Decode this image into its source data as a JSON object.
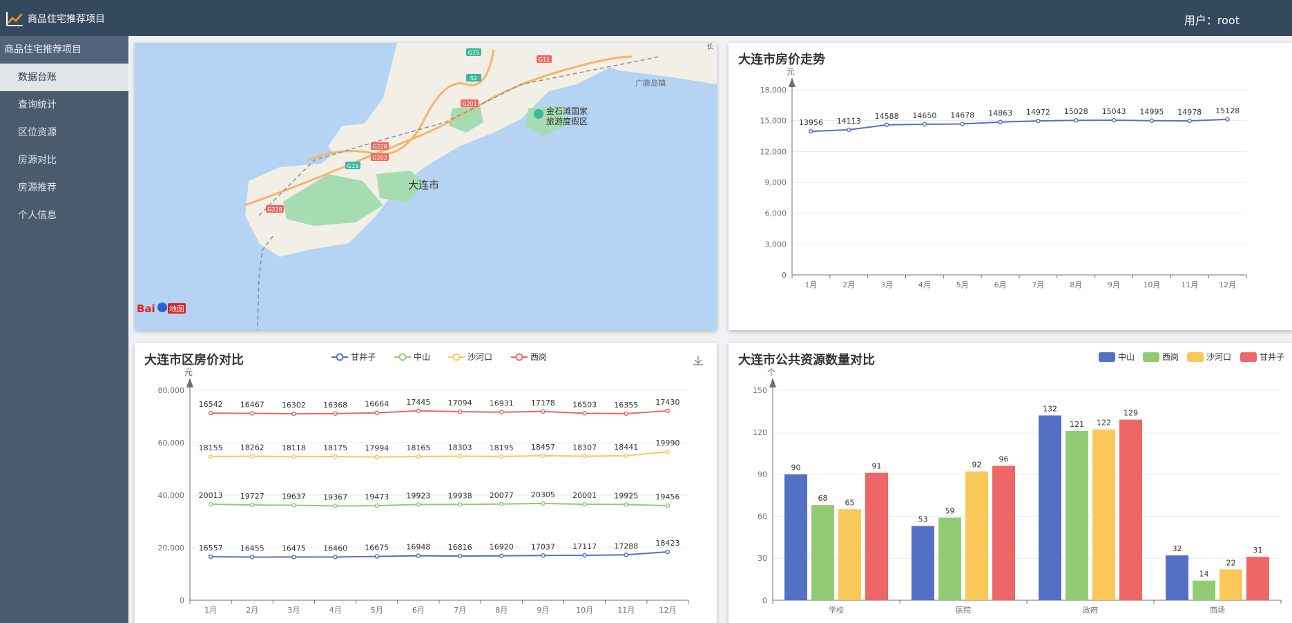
{
  "app": {
    "title": "商品住宅推荐项目",
    "user_label": "用户：root"
  },
  "sidebar": {
    "group_label": "商品住宅推荐项目",
    "items": [
      {
        "label": "数据台账",
        "active": true
      },
      {
        "label": "查询统计",
        "active": false
      },
      {
        "label": "区位资源",
        "active": false
      },
      {
        "label": "房源对比",
        "active": false
      },
      {
        "label": "房源推荐",
        "active": false
      },
      {
        "label": "个人信息",
        "active": false
      }
    ]
  },
  "map": {
    "city_label": "大连市",
    "poi_label_1": "金石滩国家",
    "poi_label_2": "旅游度假区",
    "place_label": "广鹿岛镇",
    "edge_label": "长",
    "road_labels": [
      "G15",
      "G11",
      "S2",
      "G201",
      "G228",
      "G202",
      "G15",
      "G228"
    ],
    "logo_text_1": "Bai",
    "logo_text_2": "地图"
  },
  "trend_chart": {
    "title": "大连市房价走势",
    "unit": "元"
  },
  "district_chart": {
    "title": "大连市区房价对比",
    "unit": "元"
  },
  "resource_chart": {
    "title": "大连市公共资源数量对比",
    "unit": "个"
  },
  "colors": {
    "blue": "#5470c6",
    "green": "#91cc75",
    "yellow": "#fac858",
    "red": "#ee6666"
  },
  "chart_data": [
    {
      "type": "line",
      "title": "大连市房价走势",
      "ylabel": "元",
      "categories": [
        "1月",
        "2月",
        "3月",
        "4月",
        "5月",
        "6月",
        "7月",
        "8月",
        "9月",
        "10月",
        "11月",
        "12月"
      ],
      "values": [
        13956,
        14113,
        14588,
        14650,
        14678,
        14863,
        14972,
        15028,
        15043,
        14995,
        14978,
        15128
      ],
      "ylim": [
        0,
        18000
      ],
      "yticks": [
        "0",
        "3,000",
        "6,000",
        "9,000",
        "12,000",
        "15,000",
        "18,000"
      ],
      "grid": true
    },
    {
      "type": "line",
      "title": "大连市区房价对比",
      "ylabel": "元",
      "categories": [
        "1月",
        "2月",
        "3月",
        "4月",
        "5月",
        "6月",
        "7月",
        "8月",
        "9月",
        "10月",
        "11月",
        "12月"
      ],
      "ylim": [
        0,
        80000
      ],
      "yticks": [
        "0",
        "20,000",
        "40,000",
        "60,000",
        "80,000"
      ],
      "legend": "top-center",
      "series": [
        {
          "name": "甘井子",
          "color": "#5470c6",
          "values": [
            16557,
            16455,
            16475,
            16460,
            16675,
            16948,
            16816,
            16920,
            17037,
            17117,
            17288,
            18423
          ],
          "offset": 0
        },
        {
          "name": "中山",
          "color": "#91cc75",
          "values": [
            20013,
            19727,
            19637,
            19367,
            19473,
            19923,
            19938,
            20077,
            20305,
            20001,
            19925,
            19456
          ],
          "offset": 16557
        },
        {
          "name": "沙河口",
          "color": "#fac858",
          "values": [
            18155,
            18262,
            18118,
            18175,
            17994,
            18165,
            18303,
            18195,
            18457,
            18307,
            18441,
            19990
          ],
          "offset": 36570
        },
        {
          "name": "西岗",
          "color": "#ee6666",
          "values": [
            16542,
            16467,
            16302,
            16368,
            16664,
            17445,
            17094,
            16931,
            17178,
            16503,
            16355,
            17430
          ],
          "offset": 54725
        }
      ]
    },
    {
      "type": "bar",
      "title": "大连市公共资源数量对比",
      "ylabel": "个",
      "categories": [
        "学校",
        "医院",
        "政府",
        "商场"
      ],
      "ylim": [
        0,
        150
      ],
      "yticks": [
        "0",
        "30",
        "60",
        "90",
        "120",
        "150"
      ],
      "legend": "top-right",
      "series": [
        {
          "name": "中山",
          "color": "#5470c6",
          "values": [
            90,
            53,
            132,
            32
          ]
        },
        {
          "name": "西岗",
          "color": "#91cc75",
          "values": [
            68,
            59,
            121,
            14
          ]
        },
        {
          "name": "沙河口",
          "color": "#fac858",
          "values": [
            65,
            92,
            122,
            22
          ]
        },
        {
          "name": "甘井子",
          "color": "#ee6666",
          "values": [
            91,
            96,
            129,
            31
          ]
        }
      ]
    }
  ]
}
